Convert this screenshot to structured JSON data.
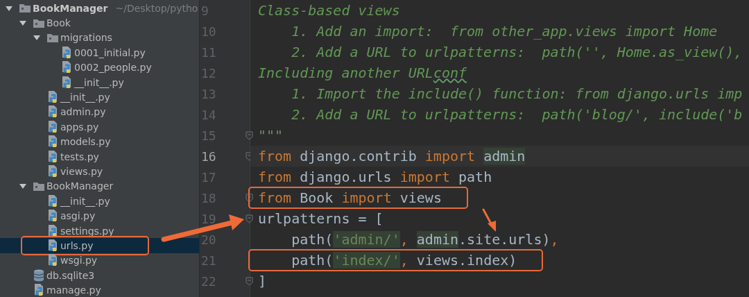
{
  "project_tree": {
    "items": [
      {
        "name": "BookManager",
        "path": "~/Desktop/pytho",
        "kind": "folder",
        "expanded": true,
        "selected": false,
        "annotated": false,
        "children": [
          {
            "name": "Book",
            "kind": "folder",
            "expanded": true,
            "selected": false,
            "annotated": false,
            "children": [
              {
                "name": "migrations",
                "kind": "folder",
                "expanded": true,
                "selected": false,
                "annotated": false,
                "children": [
                  {
                    "name": "0001_initial.py",
                    "kind": "python",
                    "selected": false,
                    "annotated": false
                  },
                  {
                    "name": "0002_people.py",
                    "kind": "python",
                    "selected": false,
                    "annotated": false
                  },
                  {
                    "name": "__init__.py",
                    "kind": "python",
                    "selected": false,
                    "annotated": false
                  }
                ]
              },
              {
                "name": "__init__.py",
                "kind": "python",
                "selected": false,
                "annotated": false
              },
              {
                "name": "admin.py",
                "kind": "python",
                "selected": false,
                "annotated": false
              },
              {
                "name": "apps.py",
                "kind": "python",
                "selected": false,
                "annotated": false
              },
              {
                "name": "models.py",
                "kind": "python",
                "selected": false,
                "annotated": false
              },
              {
                "name": "tests.py",
                "kind": "python",
                "selected": false,
                "annotated": false
              },
              {
                "name": "views.py",
                "kind": "python",
                "selected": false,
                "annotated": false
              }
            ]
          },
          {
            "name": "BookManager",
            "kind": "folder",
            "expanded": true,
            "selected": false,
            "annotated": false,
            "children": [
              {
                "name": "__init__.py",
                "kind": "python",
                "selected": false,
                "annotated": false
              },
              {
                "name": "asgi.py",
                "kind": "python",
                "selected": false,
                "annotated": false
              },
              {
                "name": "settings.py",
                "kind": "python",
                "selected": false,
                "annotated": false
              },
              {
                "name": "urls.py",
                "kind": "python",
                "selected": true,
                "annotated": true
              },
              {
                "name": "wsgi.py",
                "kind": "python",
                "selected": false,
                "annotated": false
              }
            ]
          },
          {
            "name": "db.sqlite3",
            "kind": "database",
            "selected": false,
            "annotated": false
          },
          {
            "name": "manage.py",
            "kind": "python",
            "selected": false,
            "annotated": false
          }
        ]
      }
    ]
  },
  "editor": {
    "lines": [
      {
        "number": "9",
        "current": false,
        "fold": false,
        "annotated": false,
        "tokens": [
          {
            "text": "Class-based views",
            "kind": "comment"
          }
        ]
      },
      {
        "number": "10",
        "current": false,
        "fold": false,
        "annotated": false,
        "tokens": [
          {
            "text": "    1. Add an import:  from other_app.views import Home",
            "kind": "comment"
          }
        ]
      },
      {
        "number": "11",
        "current": false,
        "fold": false,
        "annotated": false,
        "tokens": [
          {
            "text": "    2. Add a URL to urlpatterns:  path('', Home.as_view(),",
            "kind": "comment"
          }
        ]
      },
      {
        "number": "12",
        "current": false,
        "fold": false,
        "annotated": false,
        "tokens": [
          {
            "text": "Including another URL",
            "kind": "comment"
          },
          {
            "text": "conf",
            "kind": "comment",
            "typo": true
          }
        ]
      },
      {
        "number": "13",
        "current": false,
        "fold": false,
        "annotated": false,
        "tokens": [
          {
            "text": "    1. Import the include() function: from django.urls imp",
            "kind": "comment"
          }
        ]
      },
      {
        "number": "14",
        "current": false,
        "fold": false,
        "annotated": false,
        "tokens": [
          {
            "text": "    2. Add a URL to urlpatterns:  path('blog/', include('b",
            "kind": "comment"
          }
        ]
      },
      {
        "number": "15",
        "current": false,
        "fold": true,
        "annotated": false,
        "tokens": [
          {
            "text": "\"\"\"",
            "kind": "comment"
          }
        ]
      },
      {
        "number": "16",
        "current": true,
        "fold": true,
        "annotated": false,
        "tokens": [
          {
            "text": "from",
            "kind": "keyword"
          },
          {
            "text": " django.contrib ",
            "kind": "plain"
          },
          {
            "text": "import ",
            "kind": "keyword"
          },
          {
            "text": "admin",
            "kind": "plain",
            "highlight": true
          }
        ]
      },
      {
        "number": "17",
        "current": false,
        "fold": false,
        "annotated": false,
        "tokens": [
          {
            "text": "from",
            "kind": "keyword"
          },
          {
            "text": " django.urls ",
            "kind": "plain"
          },
          {
            "text": "import",
            "kind": "keyword"
          },
          {
            "text": " path",
            "kind": "plain"
          }
        ]
      },
      {
        "number": "18",
        "current": false,
        "fold": true,
        "annotated": true,
        "tokens": [
          {
            "text": "from",
            "kind": "keyword"
          },
          {
            "text": " Book ",
            "kind": "plain"
          },
          {
            "text": "import",
            "kind": "keyword"
          },
          {
            "text": " views",
            "kind": "plain"
          }
        ]
      },
      {
        "number": "19",
        "current": false,
        "fold": true,
        "annotated": false,
        "tokens": [
          {
            "text": "urlpatterns = [",
            "kind": "plain"
          }
        ]
      },
      {
        "number": "20",
        "current": false,
        "fold": false,
        "annotated": false,
        "tokens": [
          {
            "text": "    path(",
            "kind": "plain"
          },
          {
            "text": "'admin/'",
            "kind": "string",
            "highlight": true
          },
          {
            "text": ", ",
            "kind": "punct"
          },
          {
            "text": "admin",
            "kind": "plain",
            "highlight": true
          },
          {
            "text": ".site.urls)",
            "kind": "plain"
          },
          {
            "text": ",",
            "kind": "punct"
          }
        ]
      },
      {
        "number": "21",
        "current": false,
        "fold": false,
        "annotated": true,
        "tokens": [
          {
            "text": "    path(",
            "kind": "plain"
          },
          {
            "text": "'index/'",
            "kind": "string",
            "highlight": true
          },
          {
            "text": ", ",
            "kind": "punct"
          },
          {
            "text": "views.index)",
            "kind": "plain"
          }
        ]
      },
      {
        "number": "22",
        "current": false,
        "fold": true,
        "annotated": false,
        "tokens": [
          {
            "text": "]",
            "kind": "plain"
          }
        ]
      }
    ]
  }
}
